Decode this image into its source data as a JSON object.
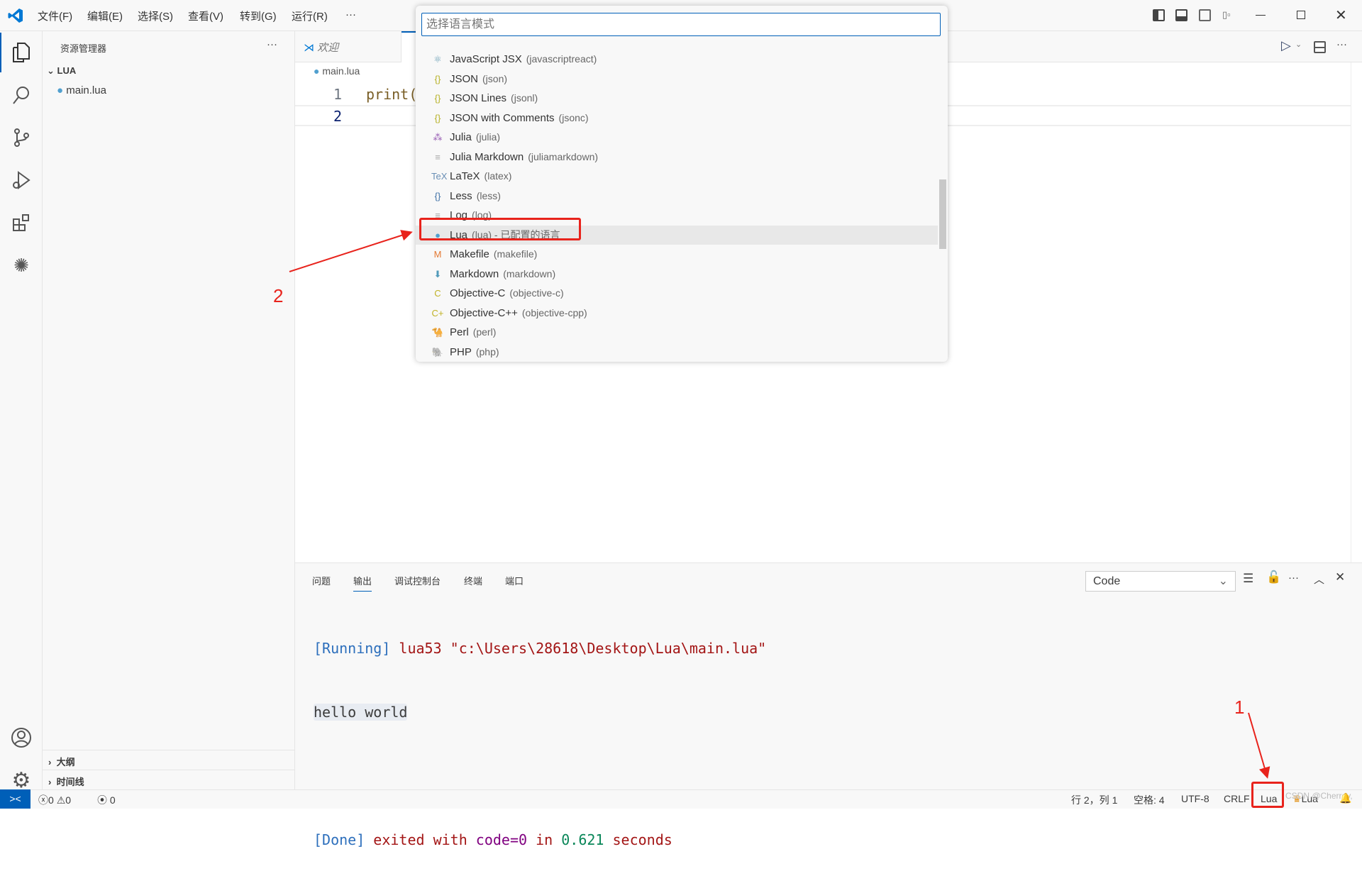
{
  "titlebar": {
    "menus": [
      "文件(F)",
      "编辑(E)",
      "选择(S)",
      "查看(V)",
      "转到(G)",
      "运行(R)",
      "···"
    ]
  },
  "sidebar": {
    "title": "资源管理器",
    "more": "···",
    "folder": "LUA",
    "files": [
      "main.lua"
    ],
    "sections": [
      "大纲",
      "时间线"
    ]
  },
  "editor": {
    "tab": "欢迎",
    "breadcrumb": "main.lua",
    "lines": [
      {
        "no": "1",
        "code": "print("
      },
      {
        "no": "2",
        "code": ""
      }
    ]
  },
  "quickpick": {
    "placeholder": "选择语言模式",
    "items": [
      {
        "icon": "react-icon",
        "glyph": "⚛",
        "color": "#6a9fb5",
        "name": "JavaScript JSX",
        "id": "(javascriptreact)"
      },
      {
        "icon": "braces-icon",
        "glyph": "{}",
        "color": "#b5b022",
        "name": "JSON",
        "id": "(json)"
      },
      {
        "icon": "braces-icon",
        "glyph": "{}",
        "color": "#b5b022",
        "name": "JSON Lines",
        "id": "(jsonl)"
      },
      {
        "icon": "braces-icon",
        "glyph": "{}",
        "color": "#b5b022",
        "name": "JSON with Comments",
        "id": "(jsonc)"
      },
      {
        "icon": "julia-icon",
        "glyph": "⁂",
        "color": "#9558b2",
        "name": "Julia",
        "id": "(julia)"
      },
      {
        "icon": "lines-icon",
        "glyph": "≡",
        "color": "#aaa",
        "name": "Julia Markdown",
        "id": "(juliamarkdown)"
      },
      {
        "icon": "tex-icon",
        "glyph": "TeX",
        "color": "#6a8fb5",
        "name": "LaTeX",
        "id": "(latex)"
      },
      {
        "icon": "braces-icon",
        "glyph": "{}",
        "color": "#3b6ea5",
        "name": "Less",
        "id": "(less)"
      },
      {
        "icon": "lines-icon",
        "glyph": "≡",
        "color": "#aaa",
        "name": "Log",
        "id": "(log)"
      },
      {
        "icon": "lua-icon",
        "glyph": "●",
        "color": "#51a0cf",
        "name": "Lua",
        "id": "(lua) - 已配置的语言"
      },
      {
        "icon": "makefile-icon",
        "glyph": "M",
        "color": "#e37933",
        "name": "Makefile",
        "id": "(makefile)"
      },
      {
        "icon": "markdown-icon",
        "glyph": "⬇",
        "color": "#519aba",
        "name": "Markdown",
        "id": "(markdown)"
      },
      {
        "icon": "objc-icon",
        "glyph": "C",
        "color": "#c1b327",
        "name": "Objective-C",
        "id": "(objective-c)"
      },
      {
        "icon": "objcpp-icon",
        "glyph": "C+",
        "color": "#c1b327",
        "name": "Objective-C++",
        "id": "(objective-cpp)"
      },
      {
        "icon": "perl-icon",
        "glyph": "🐪",
        "color": "#519aba",
        "name": "Perl",
        "id": "(perl)"
      },
      {
        "icon": "php-icon",
        "glyph": "🐘",
        "color": "#a074c4",
        "name": "PHP",
        "id": "(php)"
      }
    ],
    "selected": "Lua"
  },
  "panel": {
    "tabs": [
      "问题",
      "输出",
      "调试控制台",
      "终端",
      "端口"
    ],
    "active_tab": "输出",
    "channel": "Code",
    "output": {
      "l1_tag": "[Running]",
      "l1_cmd": "lua53 \"c:\\Users\\28618\\Desktop\\Lua\\main.lua\"",
      "l2": "hello world",
      "l3_tag": "[Done]",
      "l3_a": "exited with",
      "l3_b": "code=0",
      "l3_c": "in",
      "l3_d": "0.621",
      "l3_e": "seconds"
    }
  },
  "status": {
    "errors": "0",
    "warnings": "0",
    "ports": "0",
    "position": "行 2，列 1",
    "spaces": "空格: 4",
    "encoding": "UTF-8",
    "eol": "CRLF",
    "language": "Lua",
    "ext": "Lua",
    "watermark": "CSDN @Cherrey,"
  },
  "annotations": {
    "one": "1",
    "two": "2"
  },
  "colors": {
    "accent": "#005fb8",
    "annotation": "#e8231c"
  }
}
